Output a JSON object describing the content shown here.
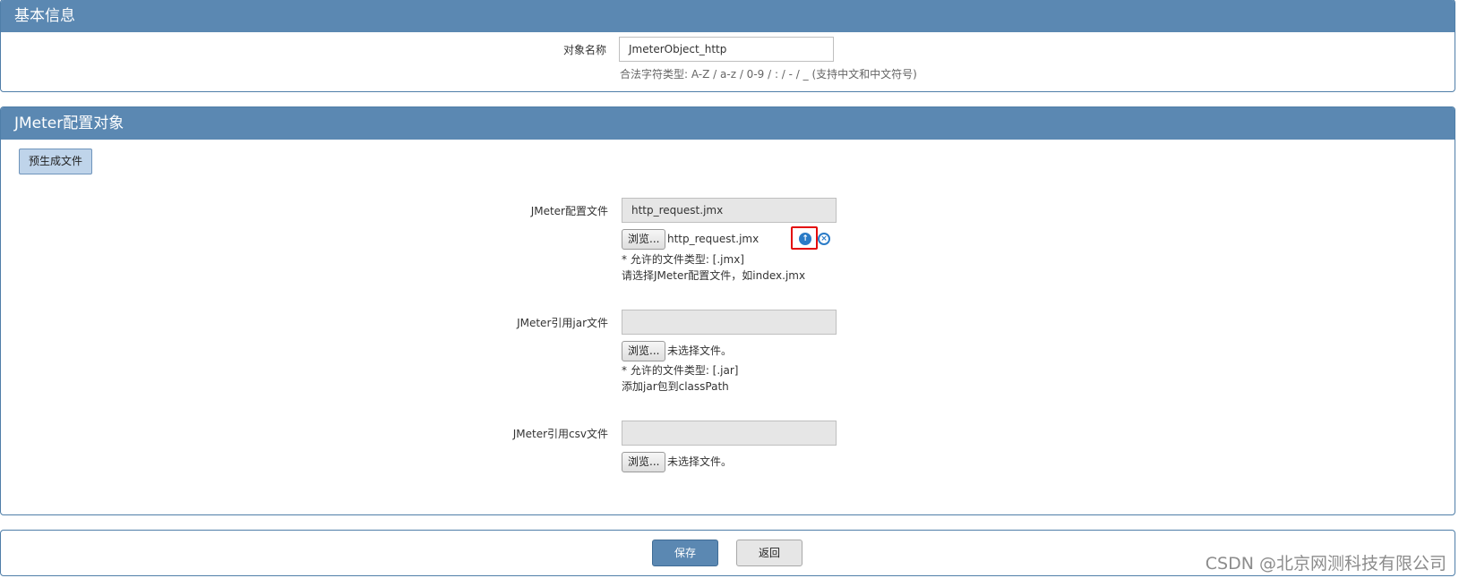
{
  "basic_info": {
    "title": "基本信息",
    "object_name_label": "对象名称",
    "object_name_value": "JmeterObject_http",
    "object_name_hint": "合法字符类型: A-Z / a-z / 0-9 / : / - / _ (支持中文和中文符号)"
  },
  "jmeter_config": {
    "title": "JMeter配置对象",
    "pregenerate_button": "预生成文件",
    "config_file": {
      "label": "JMeter配置文件",
      "value": "http_request.jmx",
      "browse_label": "浏览...",
      "selected_file": "http_request.jmx",
      "allowed_types": "* 允许的文件类型: [.jmx]",
      "help": "请选择JMeter配置文件，如index.jmx",
      "upload_icon": "upload-circle-icon",
      "remove_icon": "remove-circle-icon"
    },
    "jar_file": {
      "label": "JMeter引用jar文件",
      "value": "",
      "browse_label": "浏览...",
      "selected_file": "未选择文件。",
      "allowed_types": "* 允许的文件类型: [.jar]",
      "help": "添加jar包到classPath"
    },
    "csv_file": {
      "label": "JMeter引用csv文件",
      "value": "",
      "browse_label": "浏览...",
      "selected_file": "未选择文件。"
    }
  },
  "footer": {
    "save_label": "保存",
    "back_label": "返回"
  },
  "watermark": "CSDN @北京网测科技有限公司",
  "colors": {
    "header_bg": "#5b88b2",
    "highlight_border": "#e30b0b",
    "icon_blue": "#2a7bc7"
  }
}
